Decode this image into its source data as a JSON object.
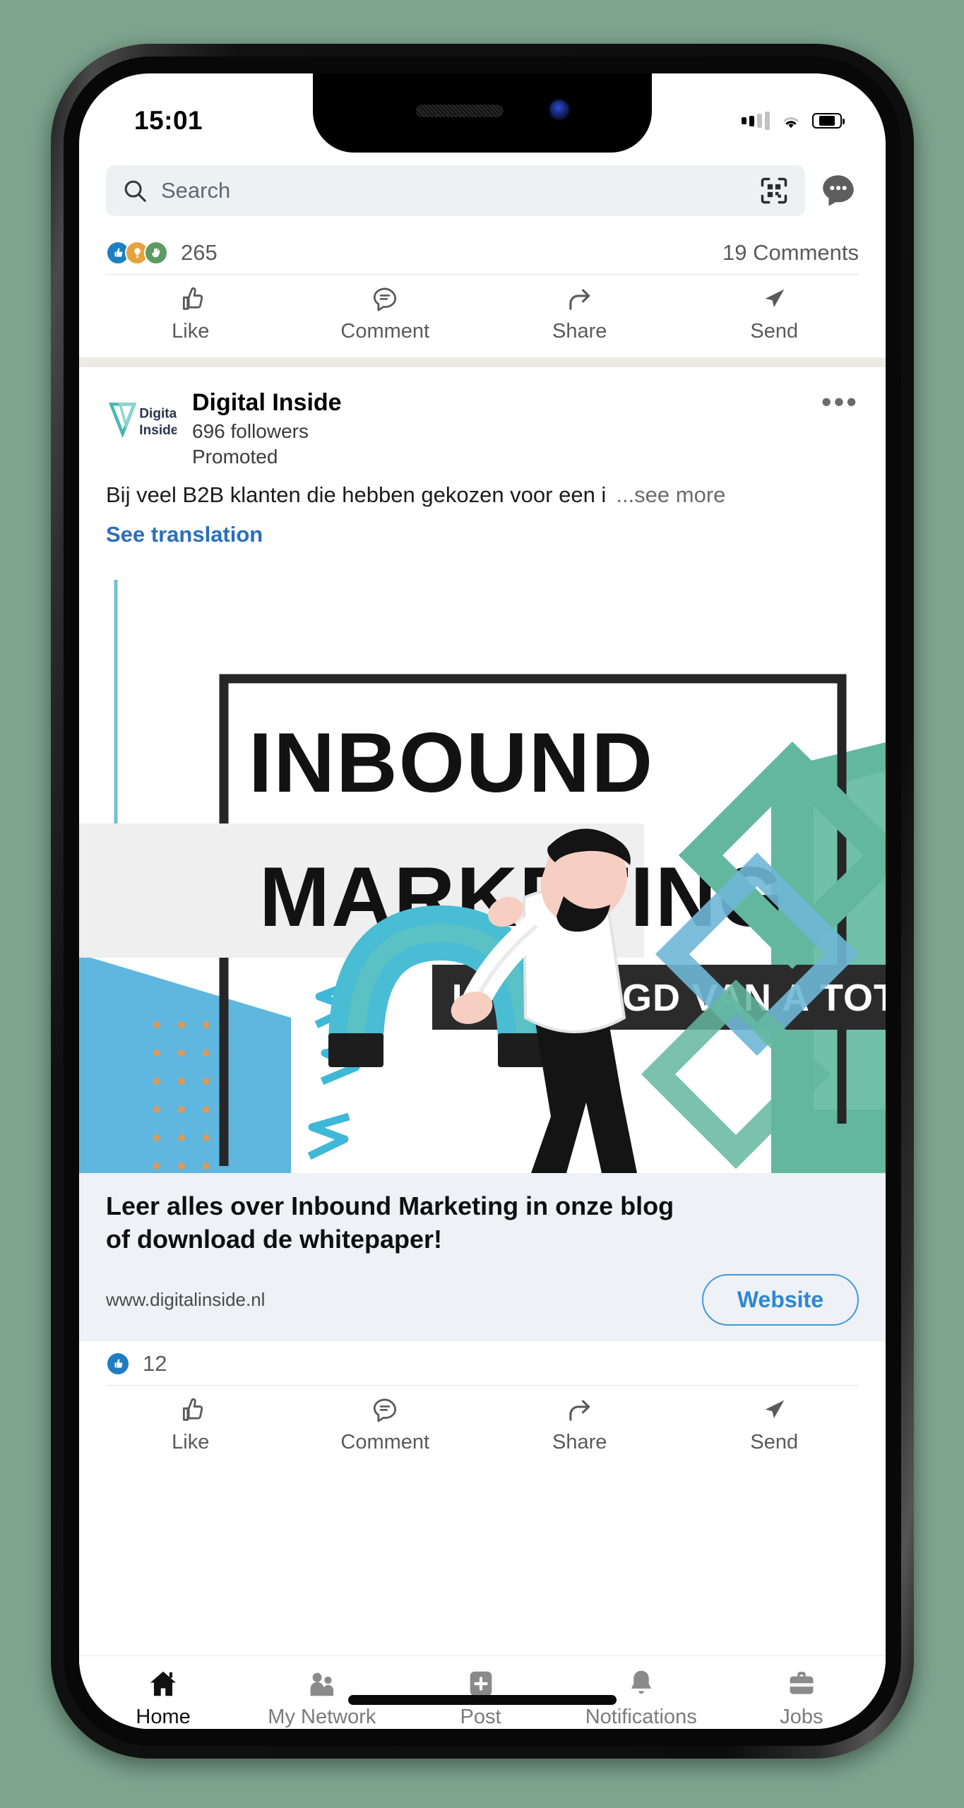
{
  "status_bar": {
    "time": "15:01",
    "signal_icon": "cellular-signal-icon",
    "signal_bars_filled": 2,
    "wifi_icon": "wifi-icon",
    "battery_icon": "battery-icon",
    "battery_percent": 64
  },
  "top_bar": {
    "search_icon": "search-icon",
    "search_value": "",
    "search_placeholder": "Search",
    "qr_icon": "qr-scan-icon",
    "messaging_icon": "messaging-bubble-icon"
  },
  "post_above": {
    "reactions": {
      "like_icon": "thumbs-up-reaction-icon",
      "insightful_icon": "lightbulb-reaction-icon",
      "celebrate_icon": "clap-reaction-icon",
      "count": "265",
      "comments": "19 Comments"
    },
    "actions": [
      {
        "label": "Like",
        "icon": "thumbs-up-icon"
      },
      {
        "label": "Comment",
        "icon": "comment-bubble-icon"
      },
      {
        "label": "Share",
        "icon": "share-arrow-icon"
      },
      {
        "label": "Send",
        "icon": "send-paper-plane-icon"
      }
    ]
  },
  "promoted_post": {
    "logo_icon": "digital-inside-logo",
    "logo_text_line1": "Digital",
    "logo_text_line2": "Inside",
    "company_name": "Digital Inside",
    "followers": "696 followers",
    "promoted_label": "Promoted",
    "menu_icon": "overflow-menu-icon",
    "text": "Bij veel B2B klanten die hebben gekozen voor een i",
    "see_more": "...see more",
    "see_translation": "See translation",
    "creative": {
      "headline_line1": "INBOUND",
      "headline_line2": "MARKETING",
      "banner_text": "UITGELEGD VAN A TOT Z",
      "illustration_icon": "magnet-man-illustration",
      "colors": {
        "teal": "#5ec0c0",
        "light_blue": "#62b6e0",
        "green_teal": "#62b79e",
        "dark": "#262626",
        "orange_dots": "#d99a5c"
      }
    },
    "caption_line1": "Leer alles over Inbound Marketing in onze blog",
    "caption_line2": "of download de whitepaper!",
    "url": "www.digitalinside.nl",
    "cta_label": "Website",
    "cta_color": "#2f86d4",
    "reactions": {
      "like_icon": "thumbs-up-reaction-icon",
      "count": "12"
    },
    "actions": [
      {
        "label": "Like",
        "icon": "thumbs-up-icon"
      },
      {
        "label": "Comment",
        "icon": "comment-bubble-icon"
      },
      {
        "label": "Share",
        "icon": "share-arrow-icon"
      },
      {
        "label": "Send",
        "icon": "send-paper-plane-icon"
      }
    ]
  },
  "bottom_nav": {
    "items": [
      {
        "label": "Home",
        "icon": "home-icon",
        "active": true
      },
      {
        "label": "My Network",
        "icon": "my-network-icon",
        "active": false
      },
      {
        "label": "Post",
        "icon": "post-plus-icon",
        "active": false
      },
      {
        "label": "Notifications",
        "icon": "bell-icon",
        "active": false
      },
      {
        "label": "Jobs",
        "icon": "briefcase-icon",
        "active": false
      }
    ]
  }
}
